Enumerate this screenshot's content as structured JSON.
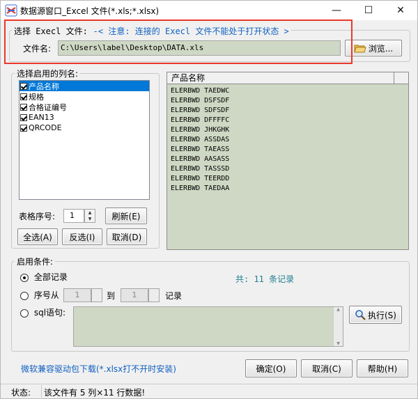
{
  "window": {
    "title": "数据源窗口_Excel 文件(*.xls;*.xlsx)",
    "minimize_glyph": "—",
    "maximize_glyph": "☐",
    "close_glyph": "✕"
  },
  "excel_group": {
    "legend_label": "选择 Execl 文件:",
    "legend_note": "-< 注意: 连接的 Execl 文件不能处于打开状态 >",
    "file_label": "文件名:",
    "file_value": "C:\\Users\\label\\Desktop\\DATA.xls",
    "browse_label": "浏览...",
    "highlight_color": "#e8392c"
  },
  "columns_group": {
    "legend": "选择启用的列名:",
    "items": [
      {
        "label": "产品名称",
        "checked": true,
        "selected": true
      },
      {
        "label": "规格",
        "checked": true,
        "selected": false
      },
      {
        "label": "合格证编号",
        "checked": true,
        "selected": false
      },
      {
        "label": "EAN13",
        "checked": true,
        "selected": false
      },
      {
        "label": "QRCODE",
        "checked": true,
        "selected": false
      }
    ],
    "table_index_label": "表格序号:",
    "table_index_value": "1",
    "refresh_label": "刷新(E)",
    "select_all_label": "全选(A)",
    "invert_label": "反选(I)",
    "cancel_label": "取消(D)"
  },
  "preview": {
    "header": "产品名称",
    "rows": [
      "ELERBWD TAEDWC",
      "ELERBWD DSFSDF",
      "ELERBWD SDFSDF",
      "ELERBWD DFFFFC",
      "ELERBWD JHKGHK",
      "ELERBWD ASSDAS",
      "ELERBWD TAEASS",
      "ELERBWD AASASS",
      "ELERBWD TASSSD",
      "ELERBWD TEERDD",
      "ELERBWD TAEDAA"
    ]
  },
  "conditions": {
    "legend": "启用条件:",
    "all_records_label": "全部记录",
    "total_text": "共: 11 条记录",
    "range_label": "序号从",
    "range_from": "1",
    "range_to_label": "到",
    "range_to": "1",
    "records_suffix": "记录",
    "sql_label": "sql语句:",
    "execute_label": "执行(S)",
    "selected_option": "all"
  },
  "footer": {
    "driver_link": "微软兼容驱动包下载(*.xlsx打不开时安装)",
    "ok_label": "确定(O)",
    "cancel_label": "取消(C)",
    "help_label": "帮助(H)"
  },
  "status": {
    "label": "状态:",
    "text": "该文件有 5 列×11 行数据!"
  },
  "colors": {
    "accent_blue": "#1060c0",
    "total_teal": "#1f7f8f",
    "selection_blue": "#0078d7",
    "input_green": "#cfd8c4"
  }
}
